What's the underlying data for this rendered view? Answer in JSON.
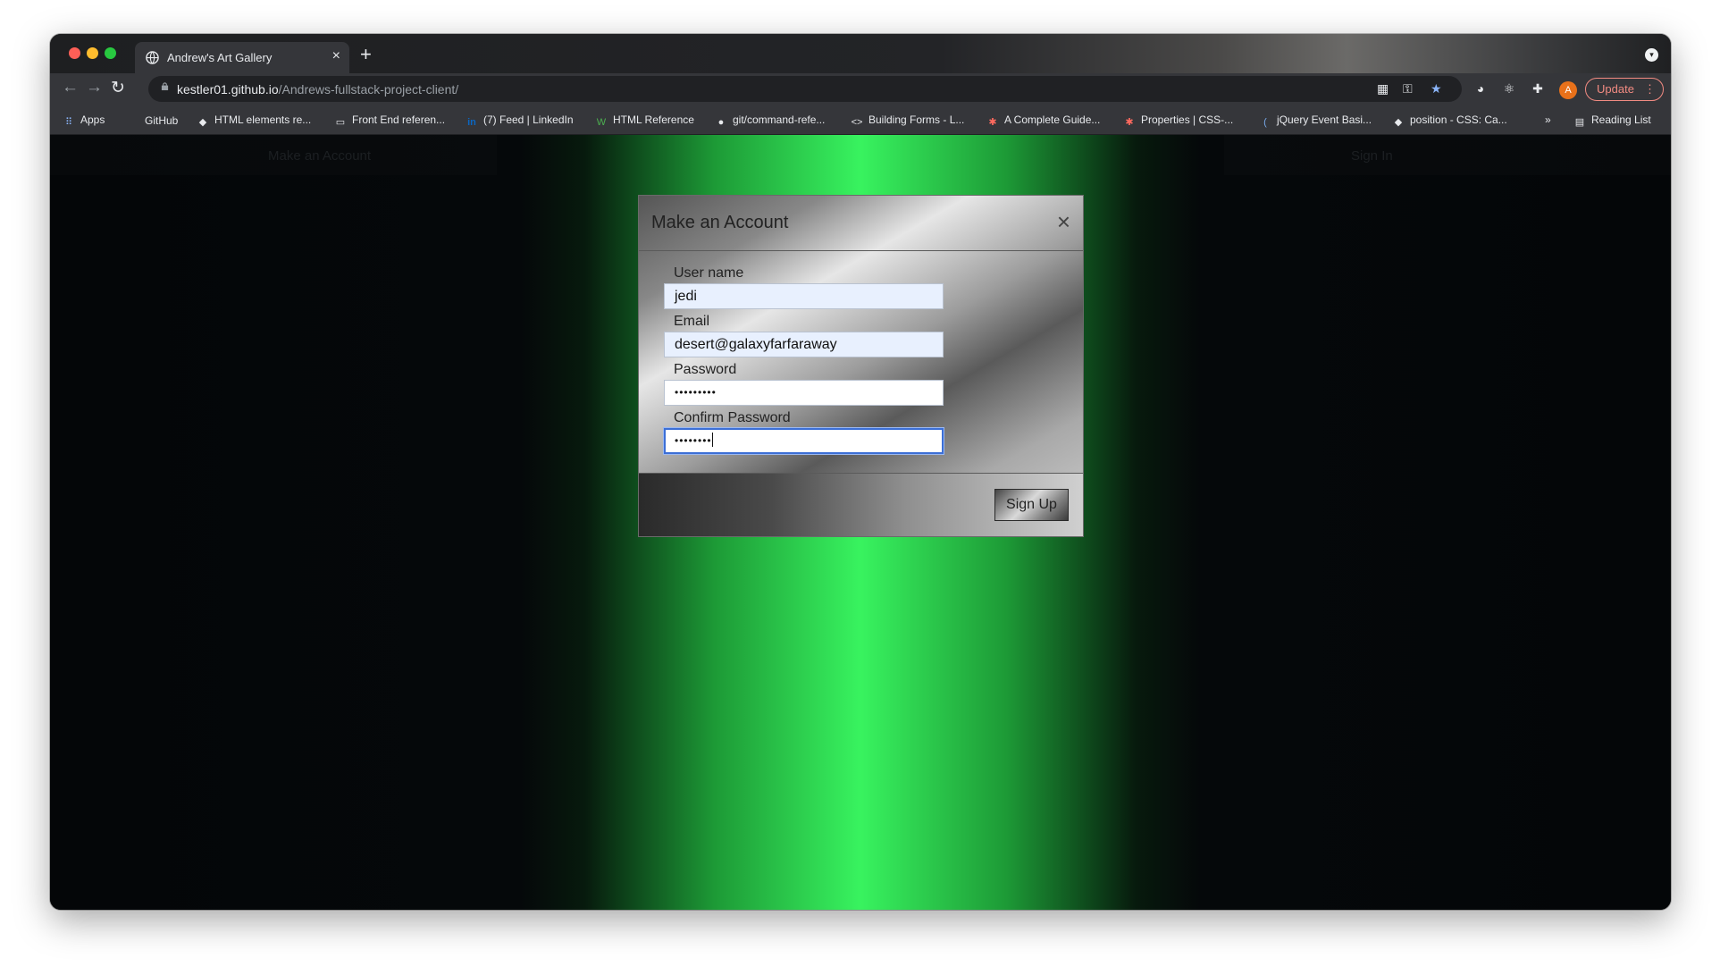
{
  "browser": {
    "tab_title": "Andrew's Art Gallery",
    "tab_close": "×",
    "new_tab": "+",
    "url_host": "kestler01.github.io",
    "url_path": "/Andrews-fullstack-project-client/",
    "avatar_letter": "A",
    "update_label": "Update",
    "update_dots": "⋮",
    "bookmarks": [
      {
        "label": "Apps",
        "icon": "apps-grid-icon"
      },
      {
        "label": "GitHub",
        "icon": "github-icon"
      },
      {
        "label": "HTML elements re...",
        "icon": "mdn-icon"
      },
      {
        "label": "Front End referen...",
        "icon": "folder-icon"
      },
      {
        "label": "(7) Feed | LinkedIn",
        "icon": "linkedin-icon"
      },
      {
        "label": "HTML Reference",
        "icon": "w3-icon"
      },
      {
        "label": "git/command-refe...",
        "icon": "github-icon"
      },
      {
        "label": "Building Forms - L...",
        "icon": "code-icon"
      },
      {
        "label": "A Complete Guide...",
        "icon": "css-tricks-icon"
      },
      {
        "label": "Properties | CSS-...",
        "icon": "css-tricks-icon"
      },
      {
        "label": "jQuery Event Basi...",
        "icon": "jquery-icon"
      },
      {
        "label": "position - CSS: Ca...",
        "icon": "mdn-icon"
      }
    ],
    "bookmarks_overflow": "»",
    "reading_list": "Reading List"
  },
  "page": {
    "nav_left": "Make an Account",
    "nav_right": "Sign In"
  },
  "modal": {
    "title": "Make an Account",
    "close": "×",
    "fields": {
      "username_label": "User name",
      "username_value": "jedi",
      "email_label": "Email",
      "email_value": "desert@galaxyfarfaraway",
      "password_label": "Password",
      "password_value": "•••••••••",
      "confirm_label": "Confirm Password",
      "confirm_value": "••••••••"
    },
    "submit_label": "Sign Up"
  },
  "colors": {
    "accent_green": "#38f35f",
    "update_red": "#f28b82",
    "focus_blue": "#3c6fd6"
  }
}
